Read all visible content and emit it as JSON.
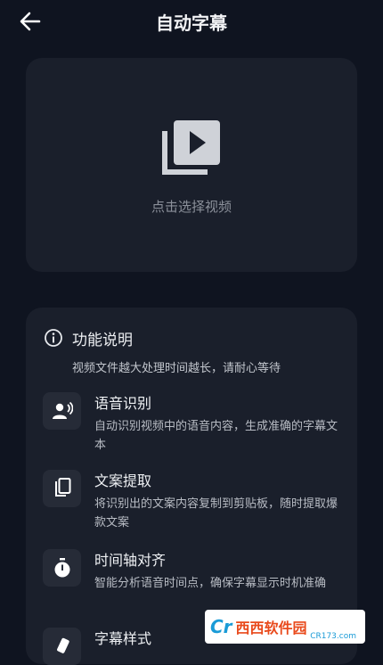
{
  "header": {
    "title": "自动字幕"
  },
  "upload": {
    "label": "点击选择视频"
  },
  "info": {
    "title": "功能说明",
    "subtitle": "视频文件越大处理时间越长，请耐心等待",
    "features": [
      {
        "icon": "voice-recognition-icon",
        "title": "语音识别",
        "desc": "自动识别视频中的语音内容，生成准确的字幕文本"
      },
      {
        "icon": "copy-icon",
        "title": "文案提取",
        "desc": "将识别出的文案内容复制到剪贴板，随时提取爆款文案"
      },
      {
        "icon": "timer-icon",
        "title": "时间轴对齐",
        "desc": "智能分析语音时间点，确保字幕显示时机准确"
      },
      {
        "icon": "style-icon",
        "title": "字幕样式",
        "desc": ""
      }
    ]
  },
  "watermark": {
    "logo": "Cr",
    "brand": "西西软件园",
    "sub": "CR173.com"
  },
  "colors": {
    "background": "#0f1420",
    "card": "#1a1f2b",
    "icon_box": "#262b37"
  }
}
